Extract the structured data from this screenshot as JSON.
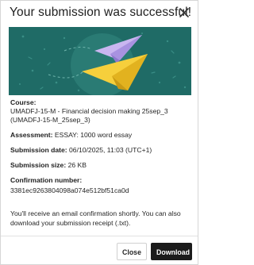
{
  "dialog": {
    "title": "Your submission was successful!",
    "close_icon": "close-icon"
  },
  "banner": {
    "icon": "paper-planes-illustration",
    "background_color": "#1f6b66",
    "plane_colors": [
      "#f6cf3c",
      "#c9b6f0"
    ]
  },
  "details": {
    "course_label": "Course:",
    "course_value": "UMADFJ-15-M - Financial decision making 25sep_3 (UMADFJ-15-M_25sep_3)",
    "assessment_label": "Assessment:",
    "assessment_value": "ESSAY: 1000 word essay",
    "submission_date_label": "Submission date:",
    "submission_date_value": "06/10/2025, 11:03 (UTC+1)",
    "submission_size_label": "Submission size:",
    "submission_size_value": "26 KB",
    "confirmation_label": "Confirmation number:",
    "confirmation_value": "3381ec9263804098a074e512bf51ca0d"
  },
  "note": "You'll receive an email confirmation shortly. You can also download your submission receipt (.txt).",
  "footer": {
    "close_label": "Close",
    "download_label": "Download"
  }
}
